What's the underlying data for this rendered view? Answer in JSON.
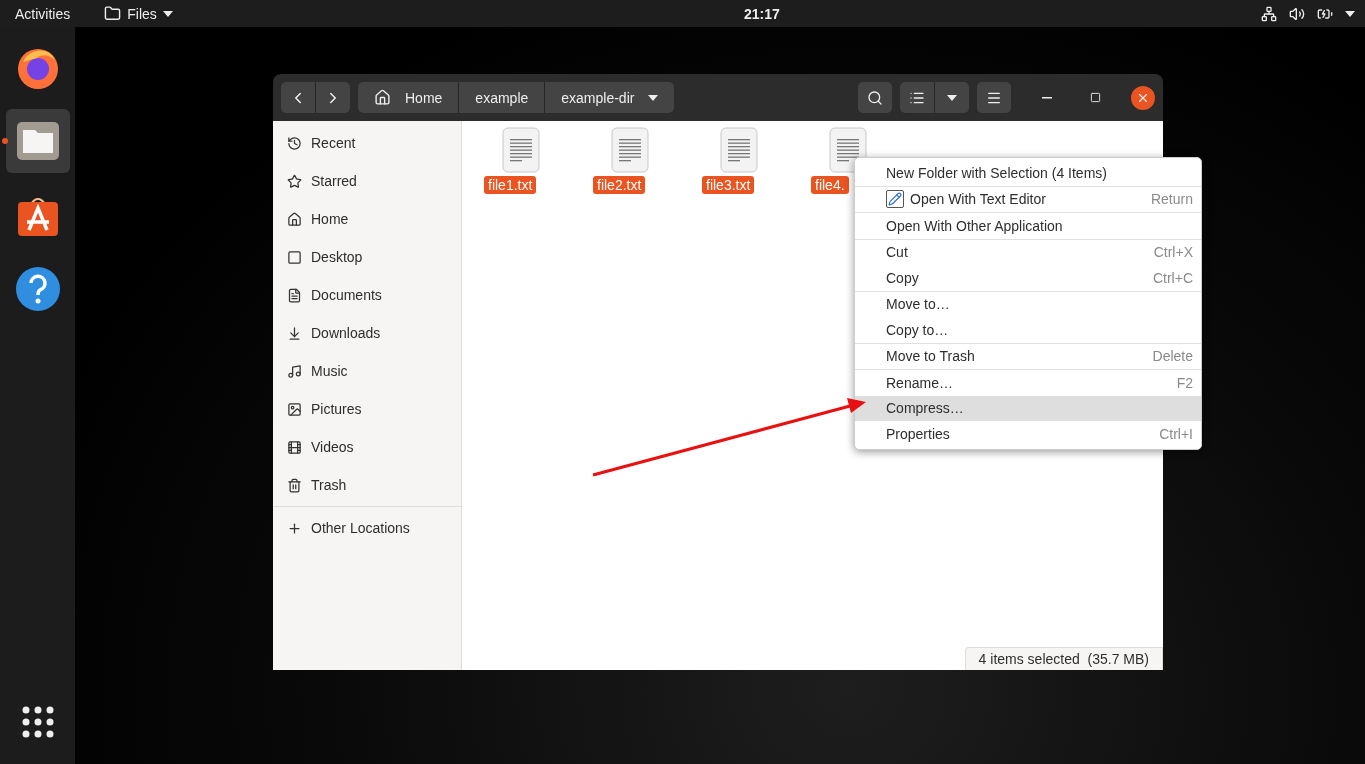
{
  "top_bar": {
    "activities": "Activities",
    "app_menu": "Files",
    "clock": "21:17"
  },
  "dock": [
    {
      "kind": "browser",
      "active": false
    },
    {
      "kind": "files",
      "active": true
    },
    {
      "kind": "store",
      "active": false
    },
    {
      "kind": "help",
      "active": false
    },
    {
      "kind": "apps",
      "active": false
    }
  ],
  "window": {
    "breadcrumb": [
      {
        "label": "Home"
      },
      {
        "label": "example"
      },
      {
        "label": "example-dir"
      }
    ],
    "sidebar": [
      {
        "label": "Recent",
        "selected": false
      },
      {
        "label": "Starred",
        "selected": false
      },
      {
        "label": "Home",
        "selected": false
      },
      {
        "label": "Desktop",
        "selected": false
      },
      {
        "label": "Documents",
        "selected": false
      },
      {
        "label": "Downloads",
        "selected": false
      },
      {
        "label": "Music",
        "selected": false
      },
      {
        "label": "Pictures",
        "selected": false
      },
      {
        "label": "Videos",
        "selected": false
      },
      {
        "label": "Trash",
        "selected": false
      }
    ],
    "other_locations": "Other Locations",
    "files": [
      {
        "name": "file1.txt",
        "selected": true
      },
      {
        "name": "file2.txt",
        "selected": true
      },
      {
        "name": "file3.txt",
        "selected": true
      },
      {
        "name": "file4.",
        "selected": true
      }
    ],
    "status": "4 items selected  (35.7 MB)"
  },
  "context_menu": [
    [
      {
        "kind": "plain",
        "label": "New Folder with Selection (4 Items)",
        "selected": false
      }
    ],
    [
      {
        "kind": "app",
        "label": "Open With Text Editor",
        "shortcut": "Return",
        "selected": false
      }
    ],
    [
      {
        "kind": "plain",
        "label": "Open With Other Application",
        "selected": false
      }
    ],
    [
      {
        "kind": "plain",
        "label": "Cut",
        "shortcut": "Ctrl+X",
        "selected": false
      },
      {
        "kind": "plain",
        "label": "Copy",
        "shortcut": "Ctrl+C",
        "selected": false
      }
    ],
    [
      {
        "kind": "plain",
        "label": "Move to…",
        "selected": false
      },
      {
        "kind": "plain",
        "label": "Copy to…",
        "selected": false
      }
    ],
    [
      {
        "kind": "plain",
        "label": "Move to Trash",
        "shortcut": "Delete",
        "selected": false
      }
    ],
    [
      {
        "kind": "plain",
        "label": "Rename…",
        "shortcut": "F2",
        "selected": false
      },
      {
        "kind": "plain",
        "label": "Compress…",
        "selected": true
      },
      {
        "kind": "plain",
        "label": "Properties",
        "shortcut": "Ctrl+I",
        "selected": false
      }
    ]
  ]
}
